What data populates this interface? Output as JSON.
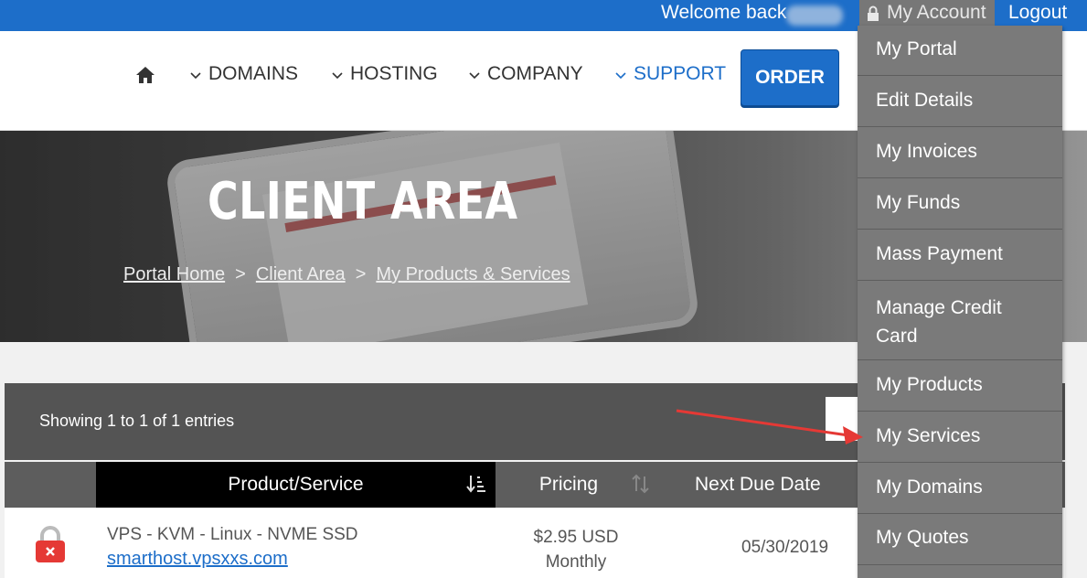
{
  "topbar": {
    "welcome": "Welcome back",
    "account": "My Account",
    "logout": "Logout"
  },
  "nav": {
    "items": [
      "DOMAINS",
      "HOSTING",
      "COMPANY",
      "SUPPORT"
    ],
    "order": "ORDER",
    "active_color": "#1d6ec9"
  },
  "hero": {
    "title": "CLIENT AREA",
    "breadcrumb": [
      "Portal Home",
      "Client Area",
      "My Products & Services"
    ],
    "separator": ">"
  },
  "table": {
    "showing": "Showing 1 to 1 of 1 entries",
    "columns": [
      "Product/Service",
      "Pricing",
      "Next Due Date"
    ],
    "rows": [
      {
        "product": "VPS - KVM - Linux - NVME SSD",
        "domain": "smarthost.vpsxxs.com",
        "price": "$2.95 USD",
        "cycle": "Monthly",
        "due": "05/30/2019"
      }
    ]
  },
  "dropdown": {
    "items": [
      "My Portal",
      "Edit Details",
      "My Invoices",
      "My Funds",
      "Mass Payment",
      "Manage Credit Card",
      "My Products",
      "My Services",
      "My Domains",
      "My Quotes"
    ]
  },
  "colors": {
    "brand": "#1d6ec9",
    "dropdown_bg": "#7a7a7a",
    "arrow": "#e53935"
  }
}
